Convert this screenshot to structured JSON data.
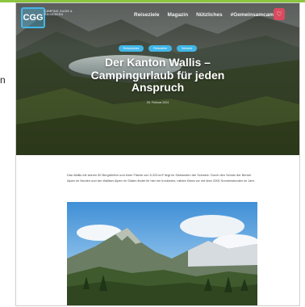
{
  "colors": {
    "accent": "#8cc63f",
    "brand": "#46b6e6",
    "tag": "#41b6e6",
    "favorite": "#d94a5e"
  },
  "side_text": "n",
  "header": {
    "logo_text": "CGG",
    "logo_subtext": "CAMPING GUIDE & REISEIDEEN",
    "nav": [
      "Reiseziele",
      "Magazin",
      "Nützliches",
      "#Gemeinsamcampen"
    ],
    "favorite_icon": "heart-icon"
  },
  "hero": {
    "tags": [
      "Reisestories",
      "Reiseziele",
      "Schweiz"
    ],
    "title_line1": "Der Kanton Wallis –",
    "title_line2": "Campingurlaub für jeden",
    "title_line3": "Anspruch",
    "date": "28. Februar 2024"
  },
  "article": {
    "intro": "Das Wallis mit seinen 50 Bergdörfern und einer Fläche von 5.224 km² liegt im Südwesten der Schweiz. Durch den Schutz der Berner Alpen im Norden und der Walliser Alpen im Süden findet ihr hier ein trockenes, mildes Klima vor mit über 2000 Sonnenstunden im Jahr."
  }
}
